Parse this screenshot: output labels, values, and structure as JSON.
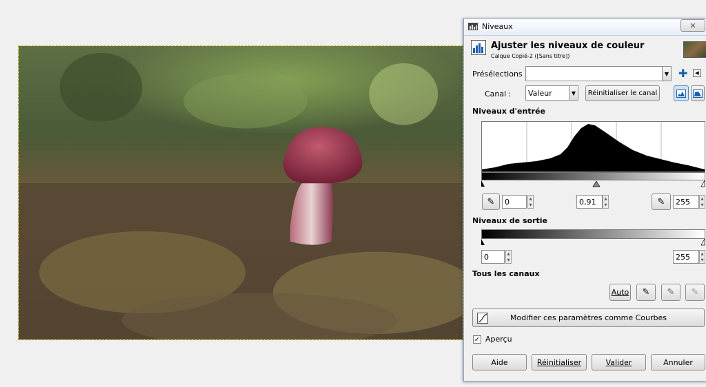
{
  "dialog": {
    "window_title": "Niveaux",
    "header_title": "Ajuster les niveaux de couleur",
    "header_subtitle": "Calque Copié-2 ([Sans titre])",
    "presets_label": "Présélections :",
    "presets_value": "",
    "channel_label": "Canal :",
    "channel_value": "Valeur",
    "reset_channel_label": "Réinitialiser le canal",
    "input_levels_title": "Niveaux d'entrée",
    "input_low": "0",
    "input_gamma": "0,91",
    "input_high": "255",
    "output_levels_title": "Niveaux de sortie",
    "output_low": "0",
    "output_high": "255",
    "all_channels_title": "Tous les canaux",
    "auto_label": "Auto",
    "curves_button_label": "Modifier ces paramètres comme Courbes",
    "preview_label": "Aperçu",
    "preview_checked": true,
    "help_label": "Aide",
    "reset_label": "Réinitialiser",
    "ok_label": "Valider",
    "cancel_label": "Annuler"
  },
  "icons": {
    "close": "close-icon",
    "add_preset": "plus-icon",
    "preset_menu": "menu-arrow-icon",
    "linear_hist": "linear-histogram-icon",
    "log_hist": "log-histogram-icon",
    "picker": "eyedropper-icon"
  },
  "colors": {
    "accent_blue": "#1a5fb4",
    "histogram": "#000000"
  }
}
